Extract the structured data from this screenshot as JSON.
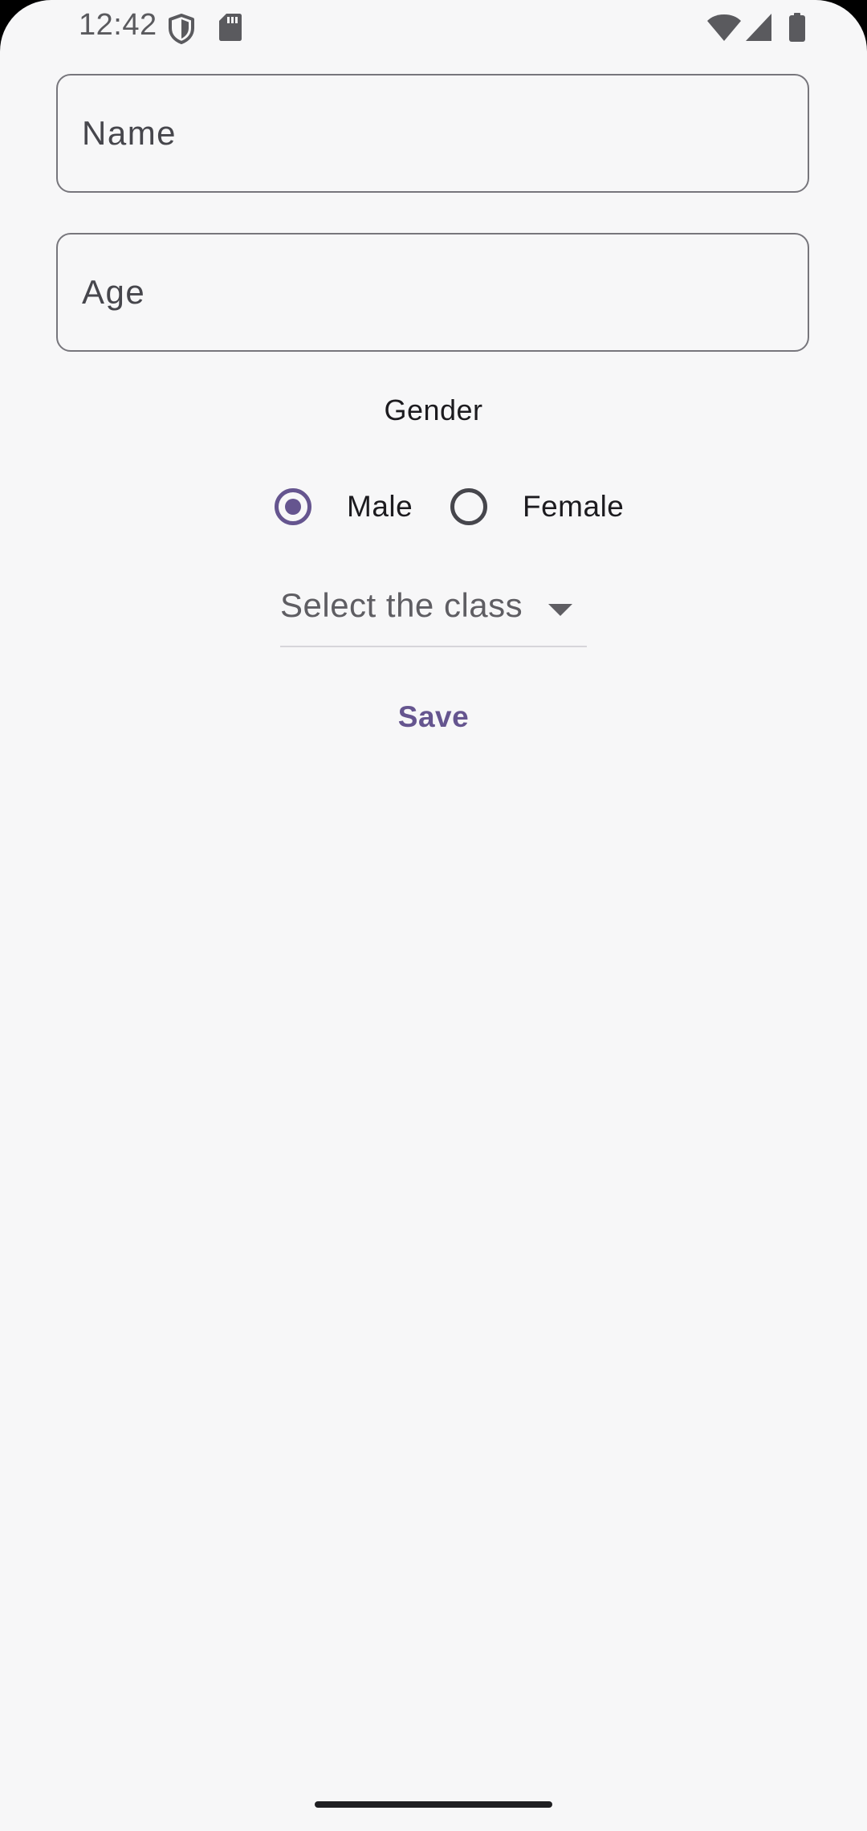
{
  "status_bar": {
    "time": "12:42",
    "icons": [
      "shield-icon",
      "sd-card-icon",
      "wifi-icon",
      "signal-icon",
      "battery-icon"
    ]
  },
  "form": {
    "name_field": {
      "placeholder": "Name",
      "value": ""
    },
    "age_field": {
      "placeholder": "Age",
      "value": ""
    },
    "gender": {
      "label": "Gender",
      "options": [
        {
          "label": "Male",
          "selected": true
        },
        {
          "label": "Female",
          "selected": false
        }
      ]
    },
    "class_select": {
      "placeholder": "Select the class"
    },
    "save_label": "Save"
  },
  "colors": {
    "accent": "#65558f",
    "background": "#f7f7f8",
    "outline": "#77767c",
    "text": "#1c1b1f"
  }
}
